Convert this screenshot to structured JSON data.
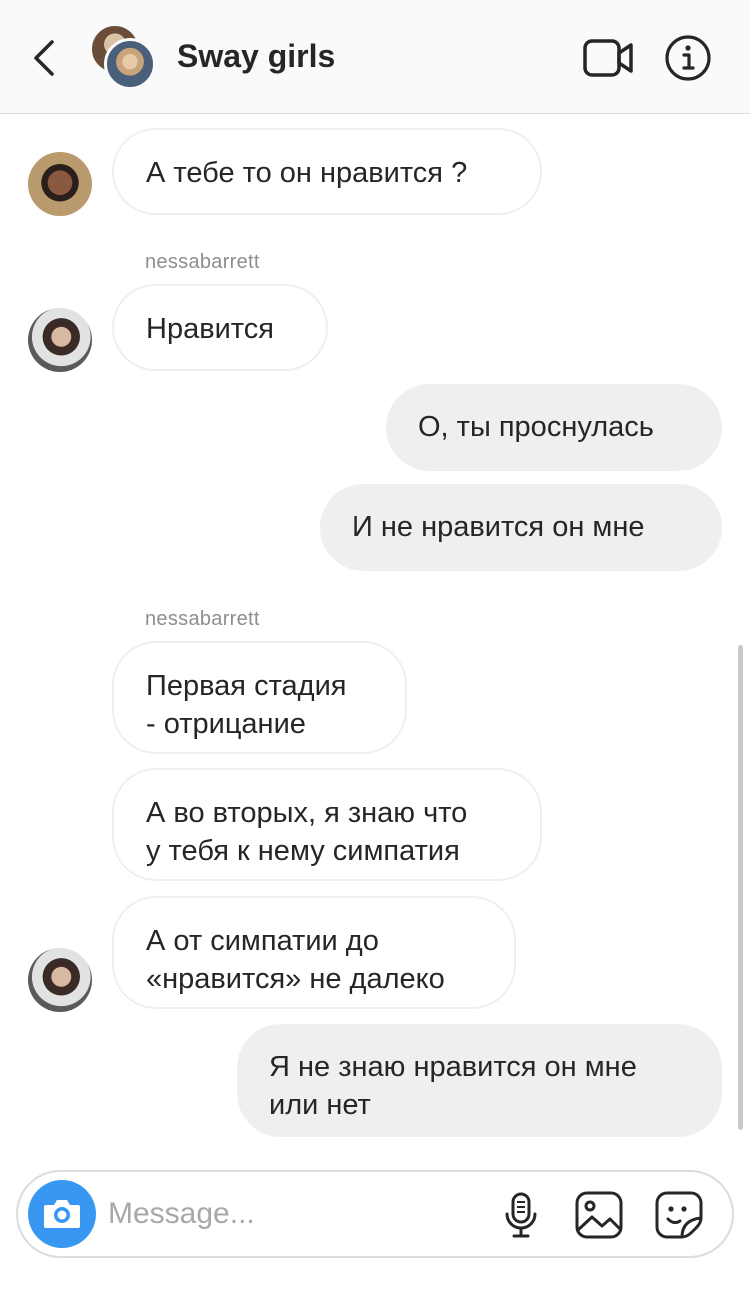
{
  "header": {
    "title": "Sway girls",
    "back_icon": "chevron-left-icon",
    "video_icon": "video-camera-icon",
    "info_icon": "info-icon"
  },
  "messages": [
    {
      "type": "in",
      "text": "А тебе то он нравится ?"
    },
    {
      "sender": "nessabarrett"
    },
    {
      "type": "in",
      "text": "Нравится"
    },
    {
      "type": "out",
      "text": "О, ты проснулась"
    },
    {
      "type": "out",
      "text": "И не нравится он мне"
    },
    {
      "sender": "nessabarrett"
    },
    {
      "type": "in",
      "lines": [
        "Первая стадия",
        "- отрицание"
      ]
    },
    {
      "type": "in",
      "lines": [
        "А во вторых, я знаю что",
        "у тебя к нему симпатия"
      ]
    },
    {
      "type": "in",
      "lines": [
        "А от симпатии до",
        "«нравится» не далеко"
      ]
    },
    {
      "type": "out",
      "lines": [
        "Я не знаю нравится он мне",
        "или нет"
      ]
    }
  ],
  "composer": {
    "placeholder": "Message...",
    "camera_icon": "camera-icon",
    "mic_icon": "microphone-icon",
    "gallery_icon": "gallery-icon",
    "sticker_icon": "sticker-icon"
  },
  "colors": {
    "accent": "#3897f0",
    "header_bg": "#fafafa",
    "outgoing_bubble": "#efefef",
    "incoming_border": "#efefef",
    "secondary_text": "#8e8e8e"
  }
}
